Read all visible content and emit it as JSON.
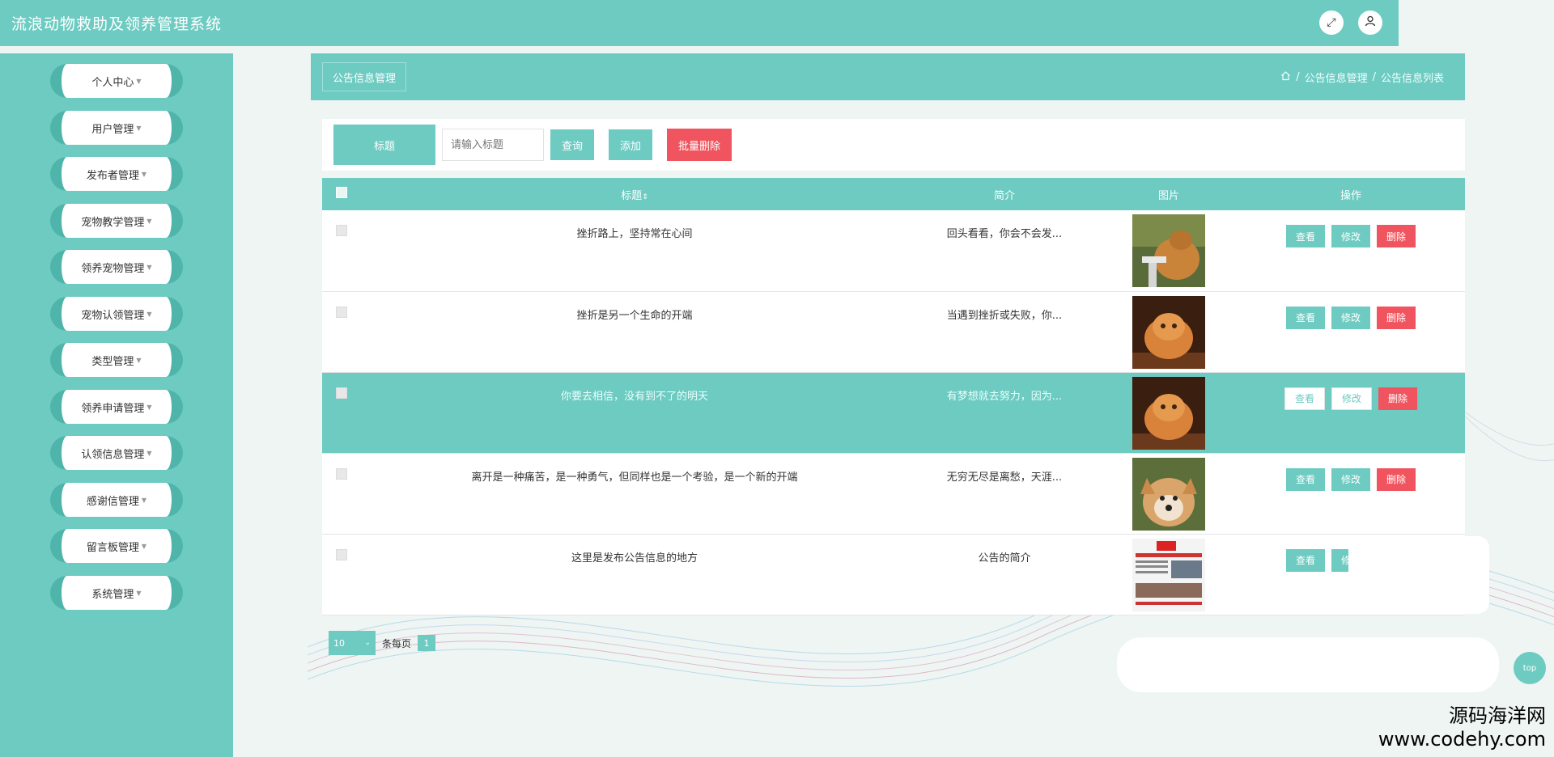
{
  "app": {
    "title": "流浪动物救助及领养管理系统"
  },
  "header": {
    "fullscreen_icon": "expand-icon",
    "user_icon": "user-icon"
  },
  "sidebar": {
    "items": [
      {
        "label": "个人中心"
      },
      {
        "label": "用户管理"
      },
      {
        "label": "发布者管理"
      },
      {
        "label": "宠物教学管理"
      },
      {
        "label": "领养宠物管理"
      },
      {
        "label": "宠物认领管理"
      },
      {
        "label": "类型管理"
      },
      {
        "label": "领养申请管理"
      },
      {
        "label": "认领信息管理"
      },
      {
        "label": "感谢信管理"
      },
      {
        "label": "留言板管理"
      },
      {
        "label": "系统管理"
      }
    ]
  },
  "page": {
    "section_title": "公告信息管理",
    "breadcrumb": [
      "公告信息管理",
      "公告信息列表"
    ],
    "breadcrumb_sep": "/"
  },
  "search": {
    "label": "标题",
    "placeholder": "请输入标题",
    "query_label": "查询",
    "add_label": "添加",
    "batch_delete_label": "批量删除"
  },
  "table": {
    "columns": {
      "title": "标题",
      "summary": "简介",
      "image": "图片",
      "actions": "操作"
    },
    "sort_icon": "sort-icon",
    "rows": [
      {
        "title": "挫折路上，坚持常在心间",
        "summary": "回头看看，你会不会发..."
      },
      {
        "title": "挫折是另一个生命的开端",
        "summary": "当遇到挫折或失败，你..."
      },
      {
        "title": "你要去相信，没有到不了的明天",
        "summary": "有梦想就去努力，因为..."
      },
      {
        "title": "离开是一种痛苦，是一种勇气，但同样也是一个考验，是一个新的开端",
        "summary": "无穷无尽是离愁，天涯..."
      },
      {
        "title": "这里是发布公告信息的地方",
        "summary": "公告的简介"
      }
    ],
    "actions": {
      "view": "查看",
      "edit": "修改",
      "delete": "删除"
    }
  },
  "pager": {
    "page_size": "10",
    "per_page_label": "条每页",
    "current_page": "1"
  },
  "watermark": {
    "name": "源码海洋网",
    "url": "www.codehy.com"
  },
  "top_button": {
    "label": "top"
  },
  "colors": {
    "primary": "#6dcbc2",
    "danger": "#f0555f"
  }
}
